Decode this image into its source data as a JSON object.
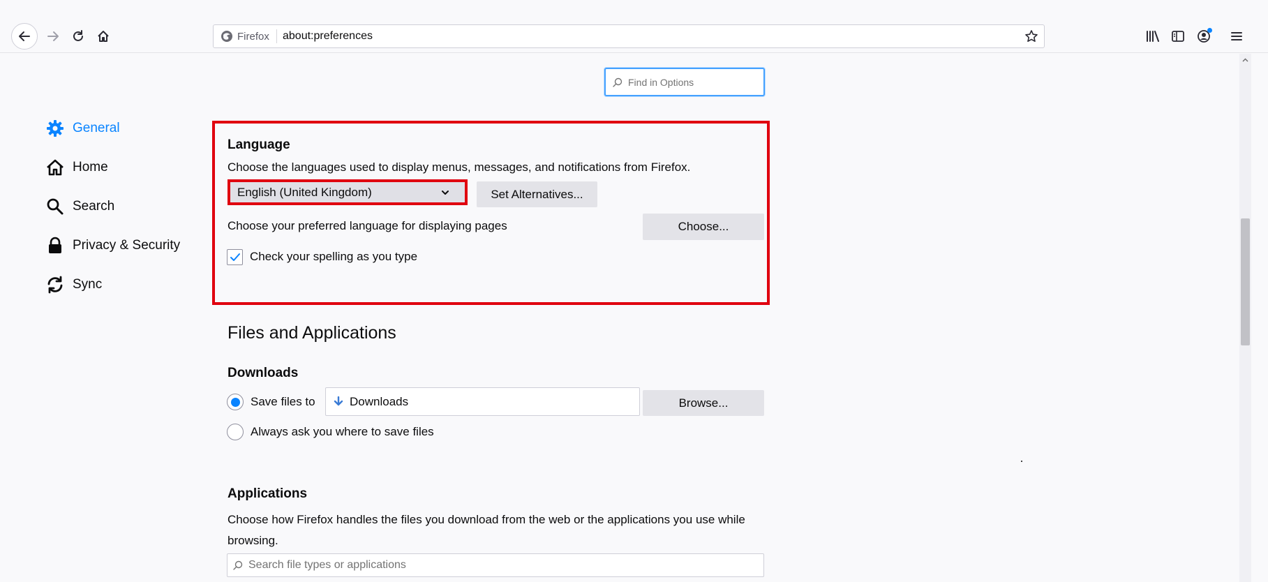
{
  "toolbar": {
    "identity_label": "Firefox",
    "url": "about:preferences",
    "icons": {
      "back": "arrow-left-icon",
      "forward": "arrow-right-icon",
      "reload": "reload-icon",
      "home": "home-icon",
      "bookmark": "star-icon",
      "library": "library-icon",
      "sidebar": "sidebar-icon",
      "account": "account-icon",
      "menu": "hamburger-menu-icon"
    }
  },
  "search_options": {
    "placeholder": "Find in Options"
  },
  "categories": [
    {
      "label": "General",
      "icon": "gear-icon",
      "selected": true
    },
    {
      "label": "Home",
      "icon": "home-icon",
      "selected": false
    },
    {
      "label": "Search",
      "icon": "search-icon",
      "selected": false
    },
    {
      "label": "Privacy & Security",
      "icon": "lock-icon",
      "selected": false
    },
    {
      "label": "Sync",
      "icon": "sync-icon",
      "selected": false
    }
  ],
  "language": {
    "title": "Language",
    "description": "Choose the languages used to display menus, messages, and notifications from Firefox.",
    "selected_language": "English (United Kingdom)",
    "set_alternatives_label": "Set Alternatives...",
    "pages_description": "Choose your preferred language for displaying pages",
    "choose_label": "Choose...",
    "spellcheck_label": "Check your spelling as you type",
    "spellcheck_checked": true
  },
  "files_apps": {
    "heading": "Files and Applications",
    "downloads_title": "Downloads",
    "save_files_label": "Save files to",
    "save_files_selected": true,
    "download_folder": "Downloads",
    "browse_label": "Browse...",
    "always_ask_label": "Always ask you where to save files",
    "applications_title": "Applications",
    "applications_description": "Choose how Firefox handles the files you download from the web or the applications you use while browsing.",
    "applications_search_placeholder": "Search file types or applications"
  },
  "colors": {
    "accent": "#0a84ff",
    "highlight_border": "#e0000f"
  }
}
